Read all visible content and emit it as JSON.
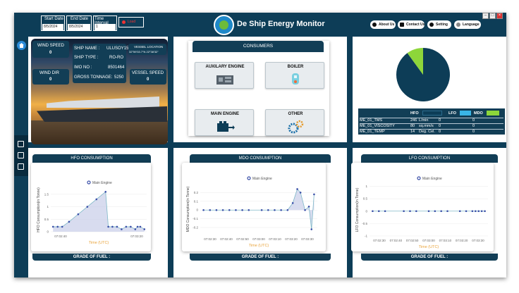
{
  "app": {
    "title": "De Ship Energy Monitor"
  },
  "filters": {
    "start_date_label": "Start Date",
    "start_date_value": "8/5/2024",
    "end_date_label": "End Date",
    "end_date_value": "8/5/2024",
    "interval_label": "Time Interval",
    "interval_value": "1",
    "load_label": "Load"
  },
  "toolbar": {
    "about_label": "About Us",
    "contact_label": "Contact Us",
    "setting_label": "Setting",
    "language_label": "Language"
  },
  "ship": {
    "wind_speed_label": "WIND SPEED",
    "wind_speed_value": "0",
    "wind_dir_label": "WIND DIR",
    "wind_dir_value": "0",
    "name_label": "SHIP NAME :",
    "name_value": "ULUSOY15",
    "type_label": "SHIP TYPE :",
    "type_value": "RO-RO",
    "imo_label": "IMO NO :",
    "imo_value": "8501464",
    "tonnage_label": "GROSS TONNAGE:",
    "tonnage_value": "5250",
    "location_label": "VESSEL LOCATION",
    "location_value": "32°59'33.7\"N 22°38'32\"",
    "vessel_speed_label": "VESSEL SPEED",
    "vessel_speed_value": "0"
  },
  "consumers": {
    "title": "CONSUMERS",
    "items": [
      {
        "label": "AUXILARY ENGINE",
        "icon": "generator-icon"
      },
      {
        "label": "BOILER",
        "icon": "boiler-icon"
      },
      {
        "label": "MAIN ENGINE",
        "icon": "engine-icon"
      },
      {
        "label": "OTHER",
        "icon": "gears-icon"
      }
    ]
  },
  "fuel_pie": {
    "chart_data": {
      "type": "pie",
      "slices": [
        {
          "label": "HFO",
          "value": 90,
          "color": "#0d3d57"
        },
        {
          "label": "LFO",
          "value": 0,
          "color": "#3ab5e6"
        },
        {
          "label": "MDO",
          "value": 10,
          "color": "#8dd63a"
        }
      ]
    },
    "legend": [
      "HFO",
      "LFO",
      "MDO"
    ],
    "colors": {
      "hfo": "#0d3d57",
      "lfo": "#3ab5e6",
      "mdo": "#8dd63a"
    }
  },
  "params_table": {
    "rows": [
      {
        "name": "ME_01_TMS",
        "value": "246",
        "unit": "L/min",
        "lfo": "0",
        "mdo": "0"
      },
      {
        "name": "ME_01_VISCOSITY",
        "value": "80",
        "unit": "sq.mm/s",
        "lfo": "0",
        "mdo": "0"
      },
      {
        "name": "ME_01_TEMP",
        "value": "14",
        "unit": "Deg. Cel.",
        "lfo": "0",
        "mdo": "0"
      }
    ]
  },
  "charts": {
    "hfo": {
      "panel_title": "HFO CONSUMPTION",
      "footer": "GRADE OF FUEL :",
      "chart_data": {
        "type": "area",
        "title": "",
        "series": [
          {
            "name": "Main Engine",
            "values": [
              0.2,
              0.2,
              0.2,
              0.4,
              0.7,
              1.0,
              1.3,
              1.6,
              0.2,
              0.2,
              0.2,
              0.1,
              0.2,
              0.2,
              0.1,
              0.2,
              0.2,
              0.1
            ]
          }
        ],
        "x": [
          0.5,
          1.5,
          2.5,
          4,
          6,
          8,
          10,
          12,
          12.6,
          13.5,
          14.5,
          15.5,
          16.5,
          17.5,
          18.5,
          19,
          19.6,
          20.5
        ],
        "xlabel": "Time (UTC)",
        "ylabel": "HFO Consumption(in Tonne)",
        "xticks": [
          "07:02:40",
          "07:03:20"
        ],
        "yticks": [
          0,
          0.5,
          1,
          1.5
        ],
        "ylim": [
          0,
          1.75
        ]
      }
    },
    "mdo": {
      "panel_title": "MDO CONSUMPTION",
      "footer": "GRADE OF FUEL :",
      "chart_data": {
        "type": "area",
        "title": "",
        "series": [
          {
            "name": "Main Engine",
            "values": [
              0,
              0,
              0,
              0,
              0,
              0,
              0,
              0,
              0,
              0,
              0,
              0,
              0,
              0.08,
              0.24,
              0.2,
              0,
              0.04,
              -0.22,
              0.18
            ]
          }
        ],
        "x": [
          0.5,
          1.5,
          2.5,
          3.5,
          4.5,
          5.5,
          6.5,
          7.5,
          9.5,
          10.5,
          11.5,
          12.5,
          13.5,
          14.3,
          15,
          15.5,
          16.2,
          16.8,
          17.2,
          17.6
        ],
        "xlabel": "Time (UTC)",
        "ylabel": "MDO Consumption(in Tonne)",
        "xticks": [
          "07:02:30",
          "07:02:40",
          "07:02:50",
          "07:03:00",
          "07:03:10",
          "07:03:20",
          "07:03:30"
        ],
        "yticks": [
          -0.2,
          -0.1,
          0,
          0.1,
          0.2
        ],
        "ylim": [
          -0.28,
          0.3
        ]
      }
    },
    "lfo": {
      "panel_title": "LFO CONSUMPTION",
      "footer": "GRADE OF FUEL :",
      "chart_data": {
        "type": "line",
        "title": "",
        "series": [
          {
            "name": "Main Engine",
            "values": [
              0,
              0,
              0,
              0,
              0,
              0,
              0,
              0,
              0,
              0,
              0,
              0,
              0,
              0,
              0,
              0,
              0
            ]
          }
        ],
        "x": [
          0.5,
          1.5,
          2.5,
          5.5,
          6.5,
          7.5,
          9.5,
          10.5,
          11.5,
          12.5,
          14.5,
          15.5,
          16.5,
          17,
          17.5,
          18,
          18.5
        ],
        "xlabel": "Time (UTC)",
        "ylabel": "LFO Consumption(in Tonne)",
        "xticks": [
          "07:02:30",
          "07:02:40",
          "07:02:50",
          "07:03:00",
          "07:03:10",
          "07:03:20",
          "07:03:30"
        ],
        "yticks": [
          -1,
          -0.5,
          0,
          0.5,
          1
        ],
        "ylim": [
          -1,
          1.1
        ]
      }
    }
  }
}
